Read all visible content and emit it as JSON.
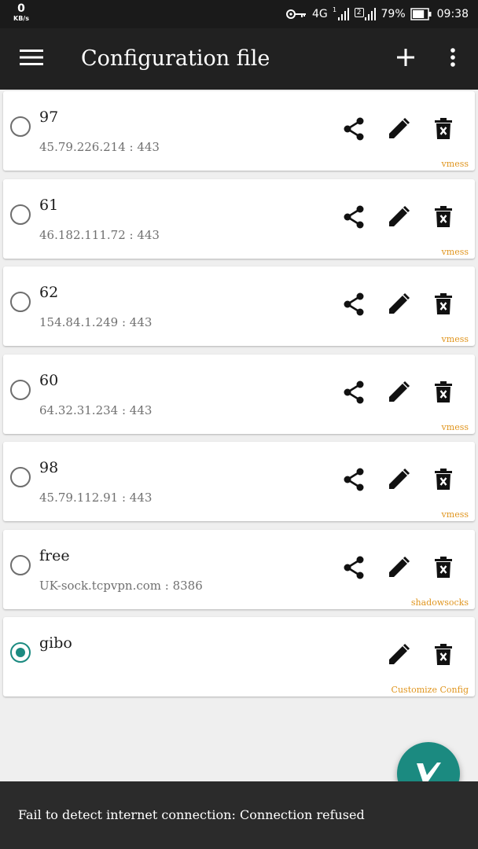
{
  "status_bar": {
    "speed_value": "0",
    "speed_unit": "KB/s",
    "network": "4G",
    "sim2_label": "2",
    "battery_percent": "79%",
    "battery_level": 0.79,
    "time": "09:38",
    "icons": [
      "key-icon",
      "signal-icon",
      "battery-icon"
    ]
  },
  "toolbar": {
    "title": "Configuration file",
    "icons": [
      "menu-icon",
      "add-icon",
      "more-vert-icon"
    ]
  },
  "configs": [
    {
      "name": "97",
      "address": "45.79.226.214 : 443",
      "type": "vmess",
      "selected": false
    },
    {
      "name": "61",
      "address": "46.182.111.72 : 443",
      "type": "vmess",
      "selected": false
    },
    {
      "name": "62",
      "address": "154.84.1.249 : 443",
      "type": "vmess",
      "selected": false
    },
    {
      "name": "60",
      "address": "64.32.31.234 : 443",
      "type": "vmess",
      "selected": false
    },
    {
      "name": "98",
      "address": "45.79.112.91 : 443",
      "type": "vmess",
      "selected": false
    },
    {
      "name": "free",
      "address": "UK-sock.tcpvpn.com : 8386",
      "type": "shadowsocks",
      "selected": false
    },
    {
      "name": "gibo",
      "address": "",
      "type": "Customize Config",
      "selected": true
    }
  ],
  "card_icons": [
    "share-icon",
    "edit-icon",
    "delete-icon"
  ],
  "fab_icon": "v-logo-icon",
  "snackbar": {
    "message": "Fail to detect internet connection: Connection refused"
  },
  "colors": {
    "toolbar": "#212121",
    "accent": "#1b8a80",
    "type_label": "#e0951e",
    "background": "#efefef"
  }
}
